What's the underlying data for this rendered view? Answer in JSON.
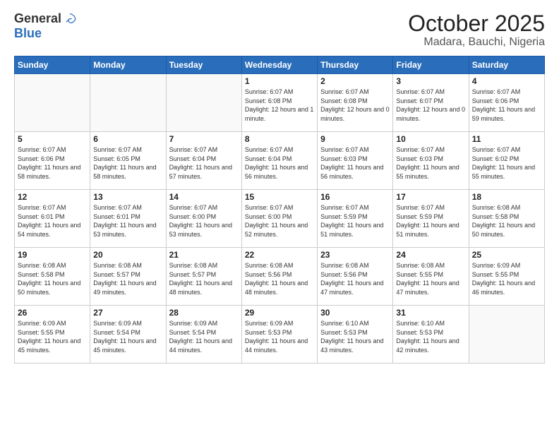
{
  "header": {
    "logo_general": "General",
    "logo_blue": "Blue",
    "month_title": "October 2025",
    "location": "Madara, Bauchi, Nigeria"
  },
  "days_of_week": [
    "Sunday",
    "Monday",
    "Tuesday",
    "Wednesday",
    "Thursday",
    "Friday",
    "Saturday"
  ],
  "weeks": [
    [
      {
        "day": "",
        "info": ""
      },
      {
        "day": "",
        "info": ""
      },
      {
        "day": "",
        "info": ""
      },
      {
        "day": "1",
        "info": "Sunrise: 6:07 AM\nSunset: 6:08 PM\nDaylight: 12 hours\nand 1 minute."
      },
      {
        "day": "2",
        "info": "Sunrise: 6:07 AM\nSunset: 6:08 PM\nDaylight: 12 hours\nand 0 minutes."
      },
      {
        "day": "3",
        "info": "Sunrise: 6:07 AM\nSunset: 6:07 PM\nDaylight: 12 hours\nand 0 minutes."
      },
      {
        "day": "4",
        "info": "Sunrise: 6:07 AM\nSunset: 6:06 PM\nDaylight: 11 hours\nand 59 minutes."
      }
    ],
    [
      {
        "day": "5",
        "info": "Sunrise: 6:07 AM\nSunset: 6:06 PM\nDaylight: 11 hours\nand 58 minutes."
      },
      {
        "day": "6",
        "info": "Sunrise: 6:07 AM\nSunset: 6:05 PM\nDaylight: 11 hours\nand 58 minutes."
      },
      {
        "day": "7",
        "info": "Sunrise: 6:07 AM\nSunset: 6:04 PM\nDaylight: 11 hours\nand 57 minutes."
      },
      {
        "day": "8",
        "info": "Sunrise: 6:07 AM\nSunset: 6:04 PM\nDaylight: 11 hours\nand 56 minutes."
      },
      {
        "day": "9",
        "info": "Sunrise: 6:07 AM\nSunset: 6:03 PM\nDaylight: 11 hours\nand 56 minutes."
      },
      {
        "day": "10",
        "info": "Sunrise: 6:07 AM\nSunset: 6:03 PM\nDaylight: 11 hours\nand 55 minutes."
      },
      {
        "day": "11",
        "info": "Sunrise: 6:07 AM\nSunset: 6:02 PM\nDaylight: 11 hours\nand 55 minutes."
      }
    ],
    [
      {
        "day": "12",
        "info": "Sunrise: 6:07 AM\nSunset: 6:01 PM\nDaylight: 11 hours\nand 54 minutes."
      },
      {
        "day": "13",
        "info": "Sunrise: 6:07 AM\nSunset: 6:01 PM\nDaylight: 11 hours\nand 53 minutes."
      },
      {
        "day": "14",
        "info": "Sunrise: 6:07 AM\nSunset: 6:00 PM\nDaylight: 11 hours\nand 53 minutes."
      },
      {
        "day": "15",
        "info": "Sunrise: 6:07 AM\nSunset: 6:00 PM\nDaylight: 11 hours\nand 52 minutes."
      },
      {
        "day": "16",
        "info": "Sunrise: 6:07 AM\nSunset: 5:59 PM\nDaylight: 11 hours\nand 51 minutes."
      },
      {
        "day": "17",
        "info": "Sunrise: 6:07 AM\nSunset: 5:59 PM\nDaylight: 11 hours\nand 51 minutes."
      },
      {
        "day": "18",
        "info": "Sunrise: 6:08 AM\nSunset: 5:58 PM\nDaylight: 11 hours\nand 50 minutes."
      }
    ],
    [
      {
        "day": "19",
        "info": "Sunrise: 6:08 AM\nSunset: 5:58 PM\nDaylight: 11 hours\nand 50 minutes."
      },
      {
        "day": "20",
        "info": "Sunrise: 6:08 AM\nSunset: 5:57 PM\nDaylight: 11 hours\nand 49 minutes."
      },
      {
        "day": "21",
        "info": "Sunrise: 6:08 AM\nSunset: 5:57 PM\nDaylight: 11 hours\nand 48 minutes."
      },
      {
        "day": "22",
        "info": "Sunrise: 6:08 AM\nSunset: 5:56 PM\nDaylight: 11 hours\nand 48 minutes."
      },
      {
        "day": "23",
        "info": "Sunrise: 6:08 AM\nSunset: 5:56 PM\nDaylight: 11 hours\nand 47 minutes."
      },
      {
        "day": "24",
        "info": "Sunrise: 6:08 AM\nSunset: 5:55 PM\nDaylight: 11 hours\nand 47 minutes."
      },
      {
        "day": "25",
        "info": "Sunrise: 6:09 AM\nSunset: 5:55 PM\nDaylight: 11 hours\nand 46 minutes."
      }
    ],
    [
      {
        "day": "26",
        "info": "Sunrise: 6:09 AM\nSunset: 5:55 PM\nDaylight: 11 hours\nand 45 minutes."
      },
      {
        "day": "27",
        "info": "Sunrise: 6:09 AM\nSunset: 5:54 PM\nDaylight: 11 hours\nand 45 minutes."
      },
      {
        "day": "28",
        "info": "Sunrise: 6:09 AM\nSunset: 5:54 PM\nDaylight: 11 hours\nand 44 minutes."
      },
      {
        "day": "29",
        "info": "Sunrise: 6:09 AM\nSunset: 5:53 PM\nDaylight: 11 hours\nand 44 minutes."
      },
      {
        "day": "30",
        "info": "Sunrise: 6:10 AM\nSunset: 5:53 PM\nDaylight: 11 hours\nand 43 minutes."
      },
      {
        "day": "31",
        "info": "Sunrise: 6:10 AM\nSunset: 5:53 PM\nDaylight: 11 hours\nand 42 minutes."
      },
      {
        "day": "",
        "info": ""
      }
    ]
  ]
}
